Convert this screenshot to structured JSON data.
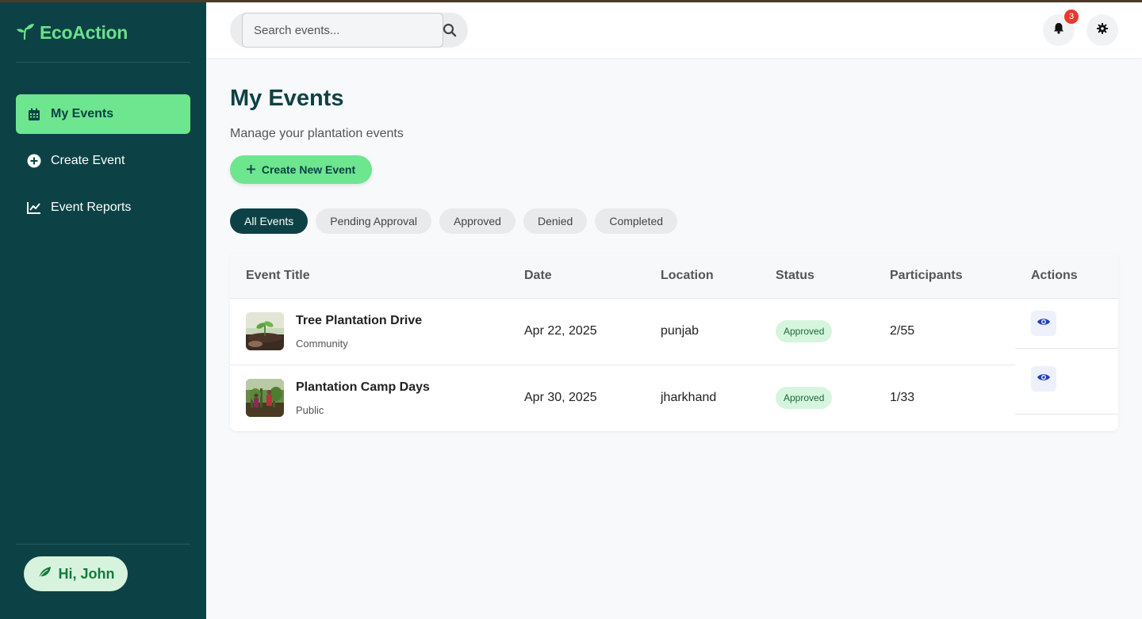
{
  "brand": {
    "name": "EcoAction"
  },
  "sidebar": {
    "items": [
      {
        "label": "My Events",
        "icon": "calendar-icon",
        "active": true
      },
      {
        "label": "Create Event",
        "icon": "plus-circle-icon",
        "active": false
      },
      {
        "label": "Event Reports",
        "icon": "line-chart-icon",
        "active": false
      }
    ],
    "greeting": "Hi, John"
  },
  "header": {
    "search_placeholder": "Search events...",
    "notification_count": "3"
  },
  "main": {
    "title": "My Events",
    "subtitle": "Manage your plantation events",
    "create_button": "Create New Event",
    "filters": [
      "All Events",
      "Pending Approval",
      "Approved",
      "Denied",
      "Completed"
    ],
    "active_filter": "All Events"
  },
  "table": {
    "columns": [
      "Event Title",
      "Date",
      "Location",
      "Status",
      "Participants",
      "Actions"
    ],
    "rows": [
      {
        "title": "Tree Plantation Drive",
        "type": "Community",
        "date": "Apr 22, 2025",
        "location": "punjab",
        "status": "Approved",
        "participants": "2/55"
      },
      {
        "title": "Plantation Camp Days",
        "type": "Public",
        "date": "Apr 30, 2025",
        "location": "jharkhand",
        "status": "Approved",
        "participants": "1/33"
      }
    ]
  },
  "colors": {
    "sidebar_bg": "#0c4245",
    "accent_green": "#6ee58f",
    "brand_green": "#6be08a",
    "status_approved_bg": "#d6f5df",
    "badge_red": "#e53a2f",
    "action_blue": "#1f3fb8"
  }
}
